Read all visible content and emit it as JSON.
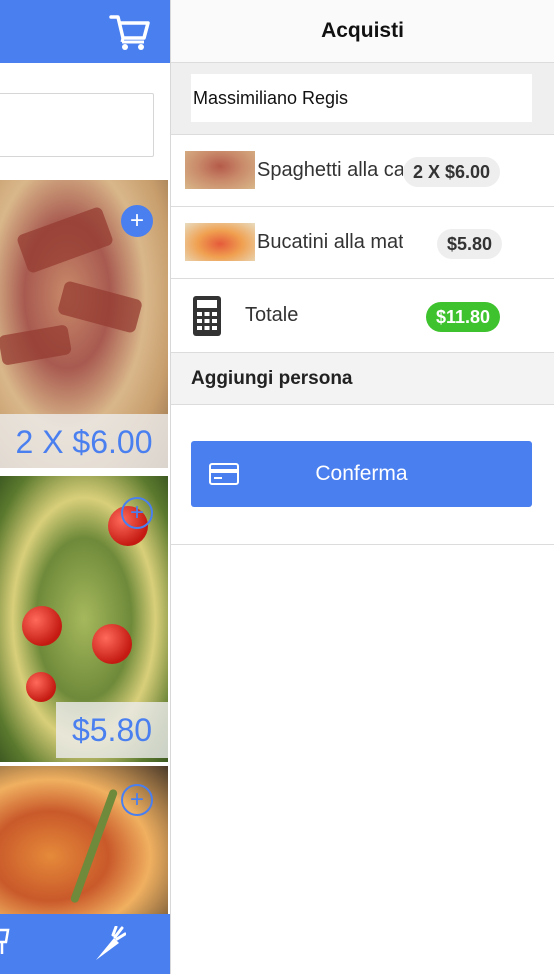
{
  "panel": {
    "title": "Acquisti",
    "customer_name": "Massimiliano Regis",
    "items": [
      {
        "name": "Spaghetti alla carbonara",
        "badge": "2 X $6.00"
      },
      {
        "name": "Bucatini alla matriciana",
        "badge": "$5.80"
      }
    ],
    "total": {
      "label": "Totale",
      "value": "$11.80"
    },
    "add_person_label": "Aggiungi persona",
    "confirm_label": "Conferma"
  },
  "menu": {
    "dishes": [
      {
        "price_label": "2 X $6.00",
        "add_icon": "plus-circle-icon"
      },
      {
        "price_label": "$5.80",
        "add_icon": "plus-circle-icon"
      },
      {
        "price_label": "",
        "add_icon": "plus-circle-icon"
      }
    ]
  },
  "icons": {
    "cart": "cart-icon",
    "calculator": "calculator-icon",
    "card": "credit-card-icon",
    "carrot": "carrot-icon"
  },
  "colors": {
    "accent": "#4a7ff0",
    "total_badge": "#3ec32e"
  }
}
